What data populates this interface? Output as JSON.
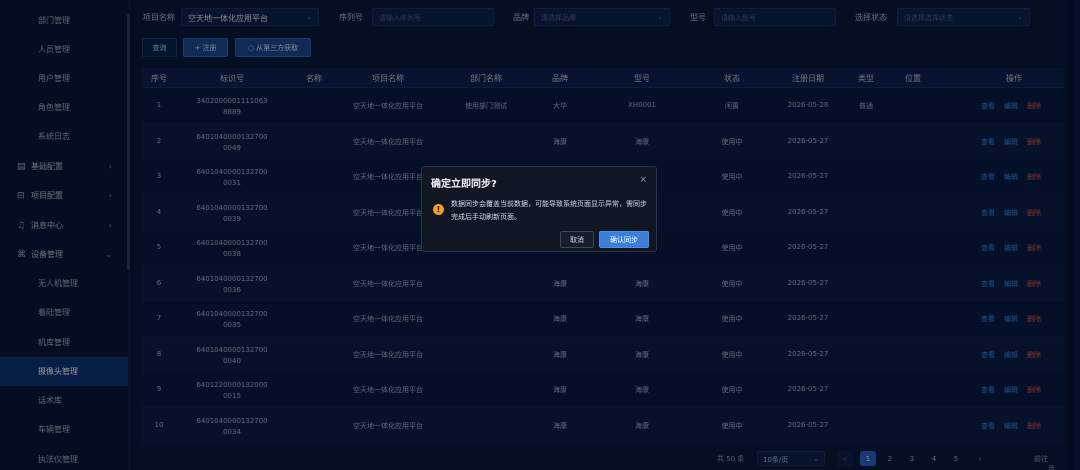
{
  "sidebar": {
    "items": [
      {
        "label": "部门管理",
        "kind": "sub"
      },
      {
        "label": "人员管理",
        "kind": "sub"
      },
      {
        "label": "用户管理",
        "kind": "sub"
      },
      {
        "label": "角色管理",
        "kind": "sub"
      },
      {
        "label": "系统日志",
        "kind": "sub"
      },
      {
        "label": "基础配置",
        "kind": "group",
        "icon": "document-icon",
        "glyph": "▤",
        "chevron": "›"
      },
      {
        "label": "项目配置",
        "kind": "group",
        "icon": "briefcase-icon",
        "glyph": "⊟",
        "chevron": "›"
      },
      {
        "label": "消息中心",
        "kind": "group",
        "icon": "bell-icon",
        "glyph": "♫",
        "chevron": "›"
      },
      {
        "label": "设备管理",
        "kind": "group",
        "icon": "devices-icon",
        "glyph": "⌘",
        "chevron": "⌄"
      },
      {
        "label": "无人机管理",
        "kind": "sub"
      },
      {
        "label": "着陆管理",
        "kind": "sub"
      },
      {
        "label": "机库管理",
        "kind": "sub"
      },
      {
        "label": "摄像头管理",
        "kind": "sub",
        "active": true
      },
      {
        "label": "话术库",
        "kind": "sub"
      },
      {
        "label": "车辆管理",
        "kind": "sub"
      },
      {
        "label": "执法仪管理",
        "kind": "sub"
      }
    ]
  },
  "filters": {
    "project_label": "项目名称",
    "project_value": "空天地一体化应用平台",
    "serial_label": "序列号",
    "serial_placeholder": "请输入序列号",
    "brand_label": "品牌",
    "brand_placeholder": "请选择品牌",
    "model_label": "型号",
    "model_placeholder": "请输入型号",
    "status_label": "选择状态",
    "status_placeholder": "请选择选择状态"
  },
  "actions": {
    "query": "查询",
    "register": "+ 注册",
    "fetch": "◌ 从第三方获取"
  },
  "table": {
    "headers": [
      "序号",
      "标识号",
      "名称",
      "项目名称",
      "部门名称",
      "品牌",
      "型号",
      "状态",
      "注册日期",
      "类型",
      "位置",
      "操作"
    ],
    "op_labels": {
      "view": "查看",
      "edit": "编辑",
      "delete": "删除"
    },
    "rows": [
      {
        "no": "1",
        "id1": "3402000001111063",
        "id2": "8889",
        "name": "",
        "project": "空天地一体化应用平台",
        "dept": "使用部门测试",
        "brand": "大华",
        "model": "XH0001",
        "status": "闲置",
        "date": "2026-05-28",
        "type": "普通",
        "pos": ""
      },
      {
        "no": "2",
        "id1": "6401040000132700",
        "id2": "0049",
        "name": "",
        "project": "空天地一体化应用平台",
        "dept": "",
        "brand": "海康",
        "model": "海康",
        "status": "使用中",
        "date": "2026-05-27",
        "type": "",
        "pos": ""
      },
      {
        "no": "3",
        "id1": "6401040000132700",
        "id2": "0031",
        "name": "",
        "project": "空天地一体化应用平台",
        "dept": "",
        "brand": "",
        "model": "",
        "status": "使用中",
        "date": "2026-05-27",
        "type": "",
        "pos": ""
      },
      {
        "no": "4",
        "id1": "6401040000132700",
        "id2": "0039",
        "name": "",
        "project": "空天地一体化应用平台",
        "dept": "",
        "brand": "",
        "model": "",
        "status": "使用中",
        "date": "2026-05-27",
        "type": "",
        "pos": ""
      },
      {
        "no": "5",
        "id1": "6401040000132700",
        "id2": "0038",
        "name": "",
        "project": "空天地一体化应用平台",
        "dept": "",
        "brand": "",
        "model": "",
        "status": "使用中",
        "date": "2026-05-27",
        "type": "",
        "pos": ""
      },
      {
        "no": "6",
        "id1": "6401040000132700",
        "id2": "0036",
        "name": "",
        "project": "空天地一体化应用平台",
        "dept": "",
        "brand": "海康",
        "model": "海康",
        "status": "使用中",
        "date": "2026-05-27",
        "type": "",
        "pos": ""
      },
      {
        "no": "7",
        "id1": "6401040000132700",
        "id2": "0035",
        "name": "",
        "project": "空天地一体化应用平台",
        "dept": "",
        "brand": "海康",
        "model": "海康",
        "status": "使用中",
        "date": "2026-05-27",
        "type": "",
        "pos": ""
      },
      {
        "no": "8",
        "id1": "6401040000132700",
        "id2": "0040",
        "name": "",
        "project": "空天地一体化应用平台",
        "dept": "",
        "brand": "海康",
        "model": "海康",
        "status": "使用中",
        "date": "2026-05-27",
        "type": "",
        "pos": ""
      },
      {
        "no": "9",
        "id1": "6401220000132000",
        "id2": "0015",
        "name": "",
        "project": "空天地一体化应用平台",
        "dept": "",
        "brand": "海康",
        "model": "海康",
        "status": "使用中",
        "date": "2026-05-27",
        "type": "",
        "pos": ""
      },
      {
        "no": "10",
        "id1": "6401040000132700",
        "id2": "0034",
        "name": "",
        "project": "空天地一体化应用平台",
        "dept": "",
        "brand": "海康",
        "model": "海康",
        "status": "使用中",
        "date": "2026-05-27",
        "type": "",
        "pos": ""
      }
    ]
  },
  "pagination": {
    "total": "共 50 条",
    "page_size": "10条/页",
    "prev": "‹",
    "pages": [
      "1",
      "2",
      "3",
      "4",
      "5"
    ],
    "current": "1",
    "next": "›",
    "goto": "前往",
    "goto_suffix": "页"
  },
  "modal": {
    "title": "确定立即同步?",
    "close": "×",
    "warn_glyph": "!",
    "message": "数据同步会覆盖当前数据，可能导致系统页面显示异常，需同步完成后手动刷新页面。",
    "cancel": "取消",
    "confirm": "确认同步"
  },
  "colors": {
    "background": "#061634",
    "active_nav": "#0d3579",
    "primary": "#3b7fd8",
    "link": "#3d8bf0",
    "danger": "#e0574f",
    "warning": "#f0a020"
  }
}
